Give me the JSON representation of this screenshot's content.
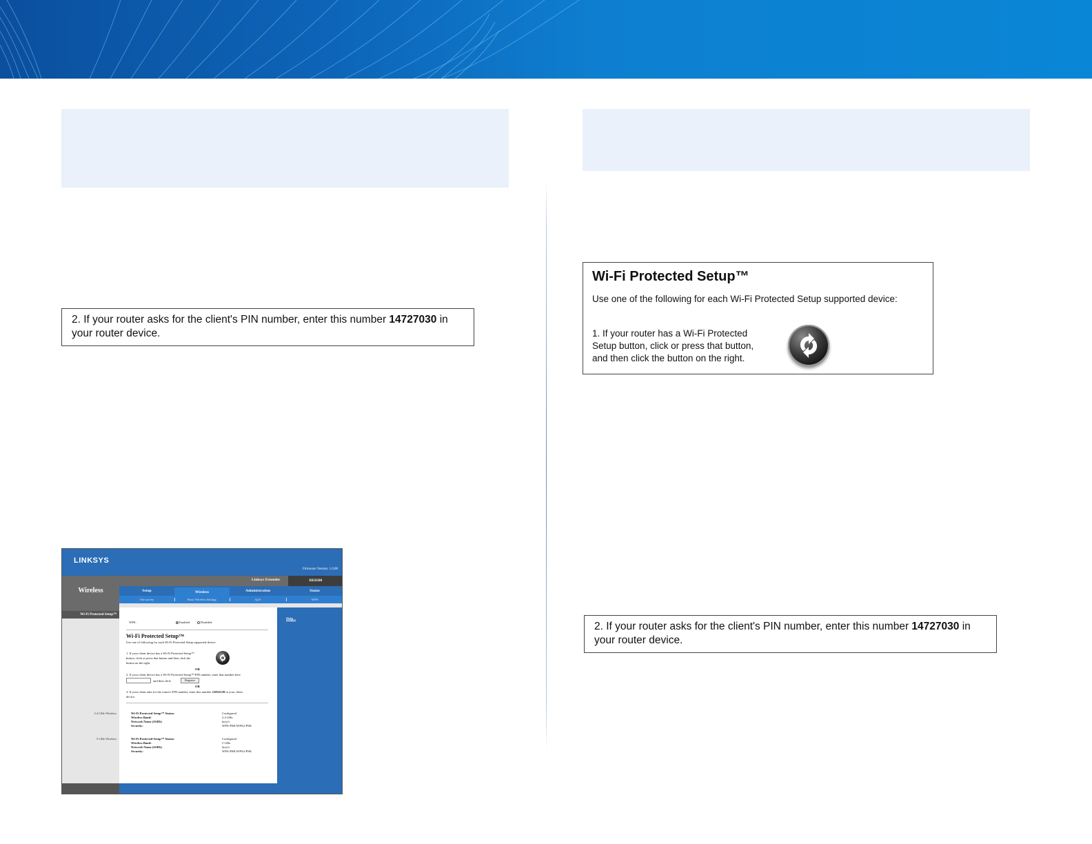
{
  "colors": {
    "banner": "#0d64b8",
    "heading_shade": "#eaf1fa",
    "linksys_blue": "#2b6db6"
  },
  "pin_box": {
    "prefix": "2. If your router asks for the client's PIN number, enter this number ",
    "pin": "14727030",
    "suffix": " in your router device."
  },
  "wps_box": {
    "title": "Wi-Fi Protected Setup™",
    "intro": "Use one of the following for each Wi-Fi Protected Setup supported device:",
    "step1": "1. If your router has a Wi-Fi Protected Setup button, click or press that button, and then click the button on the right.",
    "icon": "wps-button-icon"
  },
  "screenshot": {
    "logo": "LINKSYS",
    "firmware": "Firmware Version: 1.0.00",
    "section": "Wireless",
    "product": "Linksys Extender",
    "model": "RE6500",
    "tabs": [
      "Setup",
      "Wireless",
      "Administration",
      "Status"
    ],
    "subtabs": [
      "Site survey",
      "Basic Wireless Settings",
      "QoS",
      "WPS"
    ],
    "nav_item": "Wi-Fi Protected Setup™",
    "help": "Help...",
    "wps_label": "WPS:",
    "enabled": "Enabled",
    "disabled": "Disabled",
    "heading": "Wi-Fi Protected Setup™",
    "intro": "Use one of following for each Wi-Fi Protected Setup supported device:",
    "step1_lines": [
      "1. If your client device has a Wi-Fi Protected Setup™",
      "button, click or press that button and then click the",
      "button on the right."
    ],
    "or": "OR",
    "step2": "2. If your client device has a Wi-Fi Protected Setup™ PIN number, enter that number here",
    "and_then_click": "and then click",
    "register": "Register",
    "step3_prefix": "3. If your client asks for the router's PIN number, enter this number ",
    "step3_pin": "12032129",
    "step3_suffix": " in your client",
    "step3_line2": "device.",
    "band24_side": "2.4 GHz Wireless",
    "band5_side": "5 GHz Wireless",
    "status_labels": [
      "Wi-Fi Protected Setup™ Status:",
      "Wireless Band:",
      "Network Name (SSID):",
      "Security:"
    ],
    "band24_values": [
      "Configured",
      "2.4 GHz",
      "larry's",
      "WPA-PSK/WPA2-PSK"
    ],
    "band5_values": [
      "Configured",
      "5 GHz",
      "larry's",
      "WPA-PSK/WPA2-PSK"
    ]
  }
}
